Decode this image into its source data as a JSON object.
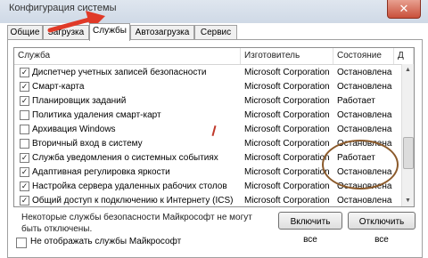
{
  "window": {
    "title": "Конфигурация системы",
    "close_glyph": "✕"
  },
  "tabs": [
    "Общие",
    "Загрузка",
    "Службы",
    "Автозагрузка",
    "Сервис"
  ],
  "columns": {
    "service": "Служба",
    "maker": "Изготовитель",
    "state": "Состояние",
    "extra": "Д"
  },
  "services": [
    {
      "checked": true,
      "name": "Диспетчер учетных записей безопасности",
      "maker": "Microsoft Corporation",
      "state": "Остановлена"
    },
    {
      "checked": true,
      "name": "Смарт-карта",
      "maker": "Microsoft Corporation",
      "state": "Остановлена"
    },
    {
      "checked": true,
      "name": "Планировщик заданий",
      "maker": "Microsoft Corporation",
      "state": "Работает"
    },
    {
      "checked": false,
      "name": "Политика удаления смарт-карт",
      "maker": "Microsoft Corporation",
      "state": "Остановлена"
    },
    {
      "checked": false,
      "name": "Архивация Windows",
      "maker": "Microsoft Corporation",
      "state": "Остановлена"
    },
    {
      "checked": false,
      "name": "Вторичный вход в систему",
      "maker": "Microsoft Corporation",
      "state": "Остановлена"
    },
    {
      "checked": true,
      "name": "Служба уведомления о системных событиях",
      "maker": "Microsoft Corporation",
      "state": "Работает"
    },
    {
      "checked": true,
      "name": "Адаптивная регулировка яркости",
      "maker": "Microsoft Corporation",
      "state": "Остановлена"
    },
    {
      "checked": true,
      "name": "Настройка сервера удаленных рабочих столов",
      "maker": "Microsoft Corporation",
      "state": "Остановлена"
    },
    {
      "checked": true,
      "name": "Общий доступ к подключению к Интернету (ICS)",
      "maker": "Microsoft Corporation",
      "state": "Остановлена"
    }
  ],
  "footer": {
    "note": "Некоторые службы безопасности Майкрософт не могут быть отключены.",
    "enable_all": "Включить все",
    "disable_all": "Отключить все",
    "hide_ms": "Не отображать службы Майкрософт"
  },
  "scroll_glyphs": {
    "up": "▲",
    "down": "▼"
  },
  "colors": {
    "arrow": "#e03a28",
    "circle": "#8b5a2b"
  }
}
